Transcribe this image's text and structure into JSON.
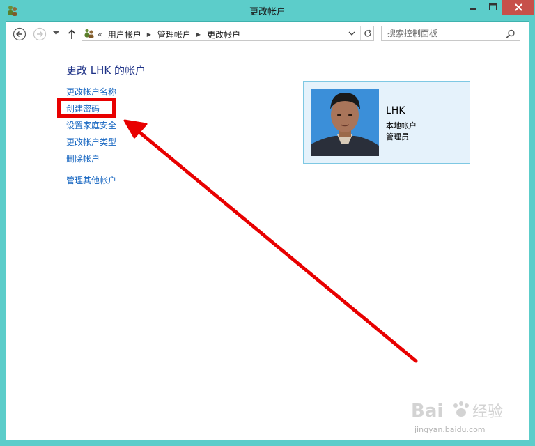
{
  "window": {
    "title": "更改帐户"
  },
  "nav": {
    "breadcrumb_lead": "«",
    "breadcrumbs": [
      "用户帐户",
      "管理帐户",
      "更改帐户"
    ]
  },
  "search": {
    "placeholder": "搜索控制面板"
  },
  "main": {
    "page_title": "更改 LHK 的帐户",
    "tasks": [
      "更改帐户名称",
      "创建密码",
      "设置家庭安全",
      "更改帐户类型",
      "删除帐户"
    ],
    "other_task": "管理其他帐户"
  },
  "account": {
    "name": "LHK",
    "type": "本地帐户",
    "role": "管理员"
  },
  "watermark": {
    "brand": "Bai 经验",
    "url": "jingyan.baidu.com"
  },
  "colors": {
    "frame": "#5ccdca",
    "title_blue": "#1e3287",
    "link_blue": "#1565c0",
    "annotation_red": "#e80000",
    "card_bg": "#e5f2fb",
    "close_button": "#c7504a"
  }
}
